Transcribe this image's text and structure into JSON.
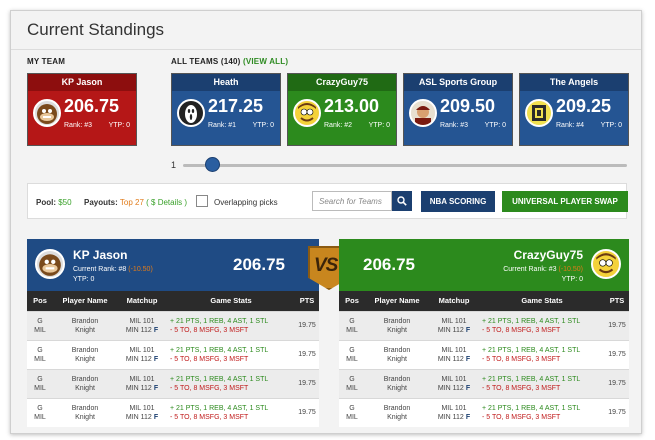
{
  "page_title": "Current Standings",
  "my_team_label": "MY TEAM",
  "all_teams_label": "ALL TEAMS (140)",
  "view_all_label": "(VIEW ALL)",
  "my_team": {
    "name": "KP Jason",
    "score": "206.75",
    "rank": "Rank: #3",
    "ytp": "YTP: 0",
    "color": "#b51717"
  },
  "teams": [
    {
      "name": "Heath",
      "score": "217.25",
      "rank": "Rank: #1",
      "ytp": "YTP: 0",
      "color": "#255593"
    },
    {
      "name": "CrazyGuy75",
      "score": "213.00",
      "rank": "Rank: #2",
      "ytp": "YTP: 0",
      "color": "#2c8a1d"
    },
    {
      "name": "ASL Sports Group",
      "score": "209.50",
      "rank": "Rank: #3",
      "ytp": "YTP: 0",
      "color": "#255593"
    },
    {
      "name": "The Angels",
      "score": "209.25",
      "rank": "Rank: #4",
      "ytp": "YTP: 0",
      "color": "#255593"
    }
  ],
  "slider": {
    "label": "1",
    "value_fraction": 0.08
  },
  "filters": {
    "pool_label": "Pool:",
    "pool_value": "$50",
    "payouts_label": "Payouts:",
    "payouts_value": "Top 27",
    "details_link": "( $ Details )",
    "overlap_label": "Overlapping picks",
    "search_placeholder": "Search for Teams",
    "nba_scoring_label": "NBA SCORING",
    "swap_label": "UNIVERSAL PLAYER SWAP"
  },
  "left_panel": {
    "name": "KP Jason",
    "rank": "Current Rank: #8",
    "delta": "(-10.50)",
    "ytp": "YTP: 0",
    "score": "206.75"
  },
  "right_panel": {
    "name": "CrazyGuy75",
    "rank": "Current Rank: #3",
    "delta": "(-10.50)",
    "ytp": "YTP: 0",
    "score": "206.75"
  },
  "vs_label": "VS",
  "columns": [
    "Pos",
    "Player Name",
    "Matchup",
    "Game Stats",
    "PTS"
  ],
  "rows": [
    {
      "pos1": "G",
      "pos2": "MIL",
      "player1": "Brandon",
      "player2": "Knight",
      "m1": "MIL 101",
      "m2": "MIN 112",
      "flag": "F",
      "plus": "+ 21 PTS, 1 REB, 4 AST, 1 STL",
      "minus": "- 5 TO, 8 MSFG, 3 MSFT",
      "pts": "19.75"
    },
    {
      "pos1": "G",
      "pos2": "MIL",
      "player1": "Brandon",
      "player2": "Knight",
      "m1": "MIL 101",
      "m2": "MIN 112",
      "flag": "F",
      "plus": "+ 21 PTS, 1 REB, 4 AST, 1 STL",
      "minus": "- 5 TO, 8 MSFG, 3 MSFT",
      "pts": "19.75"
    },
    {
      "pos1": "G",
      "pos2": "MIL",
      "player1": "Brandon",
      "player2": "Knight",
      "m1": "MIL 101",
      "m2": "MIN 112",
      "flag": "F",
      "plus": "+ 21 PTS, 1 REB, 4 AST, 1 STL",
      "minus": "- 5 TO, 8 MSFG, 3 MSFT",
      "pts": "19.75"
    },
    {
      "pos1": "G",
      "pos2": "MIL",
      "player1": "Brandon",
      "player2": "Knight",
      "m1": "MIL 101",
      "m2": "MIN 112",
      "flag": "F",
      "plus": "+ 21 PTS, 1 REB, 4 AST, 1 STL",
      "minus": "- 5 TO, 8 MSFG, 3 MSFT",
      "pts": "19.75"
    }
  ]
}
